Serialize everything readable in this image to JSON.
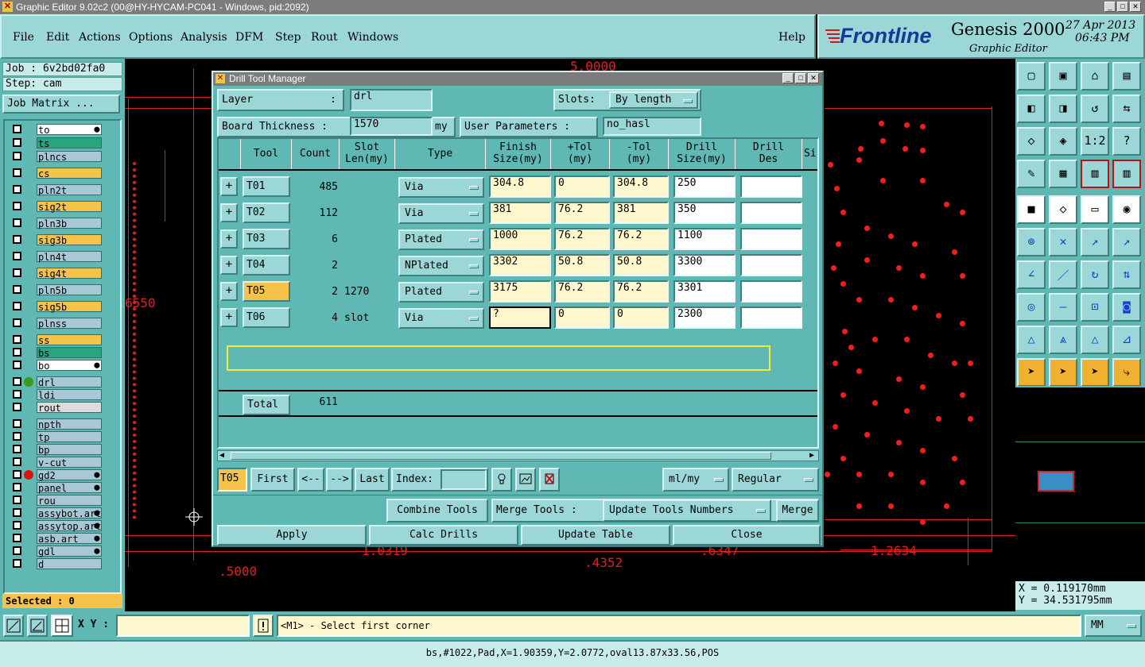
{
  "window": {
    "title": "Graphic Editor 9.02c2 (00@HY-HYCAM-PC041 - Windows, pid:2092)"
  },
  "menu": [
    "File",
    "Edit",
    "Actions",
    "Options",
    "Analysis",
    "DFM",
    "Step",
    "Rout",
    "Windows"
  ],
  "help": "Help",
  "brand": {
    "logo": "Frontline",
    "product": "Genesis 2000",
    "sub": "Graphic Editor",
    "date": "27 Apr 2013",
    "time": "06:43 PM"
  },
  "job": {
    "job_label": "Job : 6v2bd02fa0",
    "step_label": "Step: cam",
    "matrix_button": "Job Matrix ..."
  },
  "layers": [
    {
      "name": "to",
      "color": "#ffffff",
      "mark": "⬤"
    },
    {
      "name": "ts",
      "color": "#2aa37f",
      "mark": ""
    },
    {
      "name": "plncs",
      "color": "#a9c8d6",
      "mark": ""
    },
    {
      "name": "cs",
      "color": "#f6c24a",
      "mark": ""
    },
    {
      "name": "pln2t",
      "color": "#a9c8d6",
      "mark": ""
    },
    {
      "name": "sig2t",
      "color": "#f6c24a",
      "mark": ""
    },
    {
      "name": "pln3b",
      "color": "#a9c8d6",
      "mark": ""
    },
    {
      "name": "sig3b",
      "color": "#f6c24a",
      "mark": ""
    },
    {
      "name": "pln4t",
      "color": "#a9c8d6",
      "mark": ""
    },
    {
      "name": "sig4t",
      "color": "#f6c24a",
      "mark": ""
    },
    {
      "name": "pln5b",
      "color": "#a9c8d6",
      "mark": ""
    },
    {
      "name": "sig5b",
      "color": "#f6c24a",
      "mark": ""
    },
    {
      "name": "plnss",
      "color": "#a9c8d6",
      "mark": ""
    },
    {
      "name": "ss",
      "color": "#f6c24a",
      "mark": ""
    },
    {
      "name": "bs",
      "color": "#2aa37f",
      "mark": ""
    },
    {
      "name": "bo",
      "color": "#ffffff",
      "mark": "⬤"
    },
    {
      "name": "drl",
      "color": "#a9c8d6",
      "mark": ""
    },
    {
      "name": "ldi",
      "color": "#a9c8d6",
      "mark": ""
    },
    {
      "name": "rout",
      "color": "#dcdcdc",
      "mark": ""
    },
    {
      "name": "npth",
      "color": "#a9c8d6",
      "mark": ""
    },
    {
      "name": "tp",
      "color": "#a9c8d6",
      "mark": ""
    },
    {
      "name": "bp",
      "color": "#a9c8d6",
      "mark": ""
    },
    {
      "name": "v-cut",
      "color": "#a9c8d6",
      "mark": ""
    },
    {
      "name": "gd2",
      "color": "#a9c8d6",
      "mark": "⬤"
    },
    {
      "name": "panel",
      "color": "#a9c8d6",
      "mark": "⬤"
    },
    {
      "name": "rou",
      "color": "#a9c8d6",
      "mark": ""
    },
    {
      "name": "assybot.art",
      "color": "#a9c8d6",
      "mark": "⬤"
    },
    {
      "name": "assytop.art",
      "color": "#a9c8d6",
      "mark": "⬤"
    },
    {
      "name": "asb.art",
      "color": "#a9c8d6",
      "mark": "⬤"
    },
    {
      "name": "gdl",
      "color": "#a9c8d6",
      "mark": "⬤"
    },
    {
      "name": "d",
      "color": "#a9c8d6",
      "mark": ""
    }
  ],
  "selected": "Selected : 0",
  "canvas_labels": {
    "top": "5.0000",
    "left": "6550",
    "b1": "1.0319",
    "b2": ".4352",
    "b3": ".6347",
    "b4": "1.2634",
    "b5": ".5000"
  },
  "dialog": {
    "title": "Drill Tool Manager",
    "layer_label": "Layer",
    "layer_value": "drl",
    "slots_label": "Slots:",
    "slots_value": "By length",
    "thickness_label": "Board Thickness :",
    "thickness_value": "1570",
    "thickness_unit": "my",
    "user_params_label": "User Parameters :",
    "user_params_value": "no_hasl",
    "columns": [
      "Tool",
      "Count",
      "Slot Len(my)",
      "Type",
      "Finish Size(my)",
      "+Tol (my)",
      "-Tol (my)",
      "Drill Size(my)",
      "Drill Des",
      "Si"
    ],
    "rows": [
      {
        "tool": "T01",
        "count": "485",
        "slot": "",
        "type": "Via",
        "finish": "304.8",
        "ptol": "0",
        "mtol": "304.8",
        "drill": "250",
        "des": ""
      },
      {
        "tool": "T02",
        "count": "112",
        "slot": "",
        "type": "Via",
        "finish": "381",
        "ptol": "76.2",
        "mtol": "381",
        "drill": "350",
        "des": ""
      },
      {
        "tool": "T03",
        "count": "6",
        "slot": "",
        "type": "Plated",
        "finish": "1000",
        "ptol": "76.2",
        "mtol": "76.2",
        "drill": "1100",
        "des": ""
      },
      {
        "tool": "T04",
        "count": "2",
        "slot": "",
        "type": "NPlated",
        "finish": "3302",
        "ptol": "50.8",
        "mtol": "50.8",
        "drill": "3300",
        "des": ""
      },
      {
        "tool": "T05",
        "count": "2",
        "slot": "1270",
        "type": "Plated",
        "finish": "3175",
        "ptol": "76.2",
        "mtol": "76.2",
        "drill": "3301",
        "des": ""
      },
      {
        "tool": "T06",
        "count": "4",
        "slot": "slot",
        "type": "Via",
        "finish": "?",
        "ptol": "0",
        "mtol": "0",
        "drill": "2300",
        "des": ""
      }
    ],
    "total_label": "Total",
    "total_count": "611",
    "current_tool": "T05",
    "nav": {
      "first": "First",
      "prev": "<--",
      "next": "-->",
      "last": "Last",
      "index_label": "Index:"
    },
    "units_value": "ml/my",
    "mode_value": "Regular",
    "combine": "Combine Tools",
    "merge_label": "Merge Tools :",
    "merge_option": "Update Tools Numbers",
    "merge_button": "Merge",
    "apply": "Apply",
    "calc": "Calc Drills",
    "update": "Update Table",
    "close": "Close"
  },
  "coords": {
    "x": "X = 0.119170mm",
    "y": "Y = 34.531795mm"
  },
  "command": {
    "xy_label": "X Y :",
    "prompt": "<M1> - Select first corner",
    "unit": "MM"
  },
  "status": "bs,#1022,Pad,X=1.90359,Y=2.0772,oval13.87x33.56,POS",
  "colors": {
    "teal": "#5fb8b3",
    "light_teal": "#9ad7d6",
    "highlight": "#f6c24a",
    "canvas_red": "#e02020"
  }
}
